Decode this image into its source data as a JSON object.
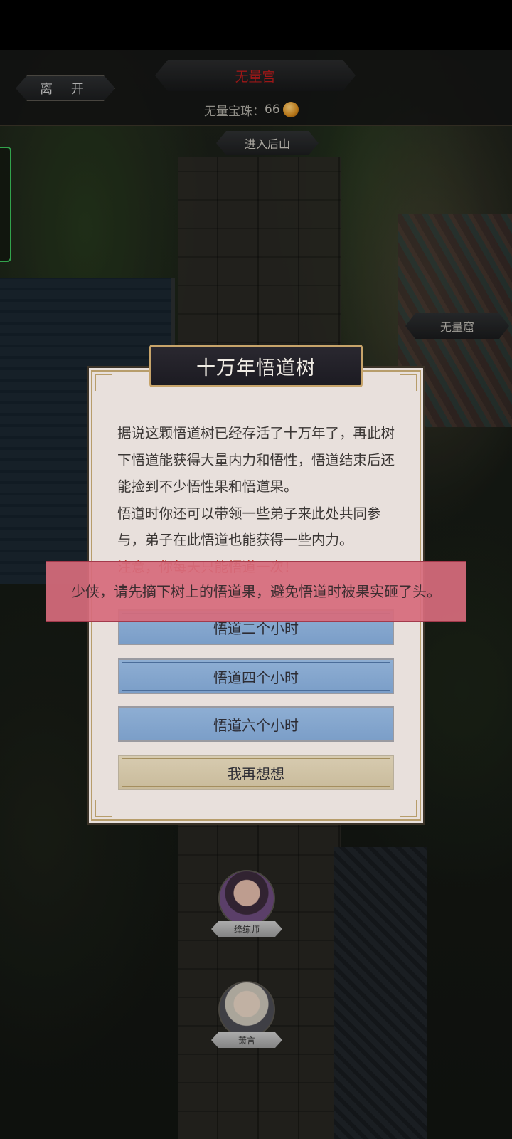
{
  "header": {
    "leave_button": "离 开",
    "location_title": "无量宫",
    "currency_label": "无量宝珠：",
    "currency_value": "66",
    "currency_icon": "pearl-icon",
    "back_mountain_button": "进入后山"
  },
  "map": {
    "cave_button": "无量窟",
    "npcs": [
      {
        "name": "绛练师",
        "icon": "female-portrait"
      },
      {
        "name": "萧言",
        "icon": "male-portrait"
      }
    ]
  },
  "dialog": {
    "title": "十万年悟道树",
    "paragraph1": "据说这颗悟道树已经存活了十万年了，再此树下悟道能获得大量内力和悟性，悟道结束后还能捡到不少悟性果和悟道果。",
    "paragraph2": "悟道时你还可以带领一些弟子来此处共同参与，弟子在此悟道也能获得一些内力。",
    "warning": "注意，你每天只能悟道一次！",
    "options": {
      "two_hours": "悟道二个小时",
      "four_hours": "悟道四个小时",
      "six_hours": "悟道六个小时",
      "reconsider": "我再想想"
    }
  },
  "toast": {
    "message": "少侠，请先摘下树上的悟道果，避免悟道时被果实砸了头。"
  },
  "colors": {
    "title_red": "#b81c1c",
    "toast_bg": "#d66c7c",
    "option_blue": "#8eaed3",
    "option_tan": "#d7cbb0",
    "dialog_bg": "#e8e0dc"
  }
}
